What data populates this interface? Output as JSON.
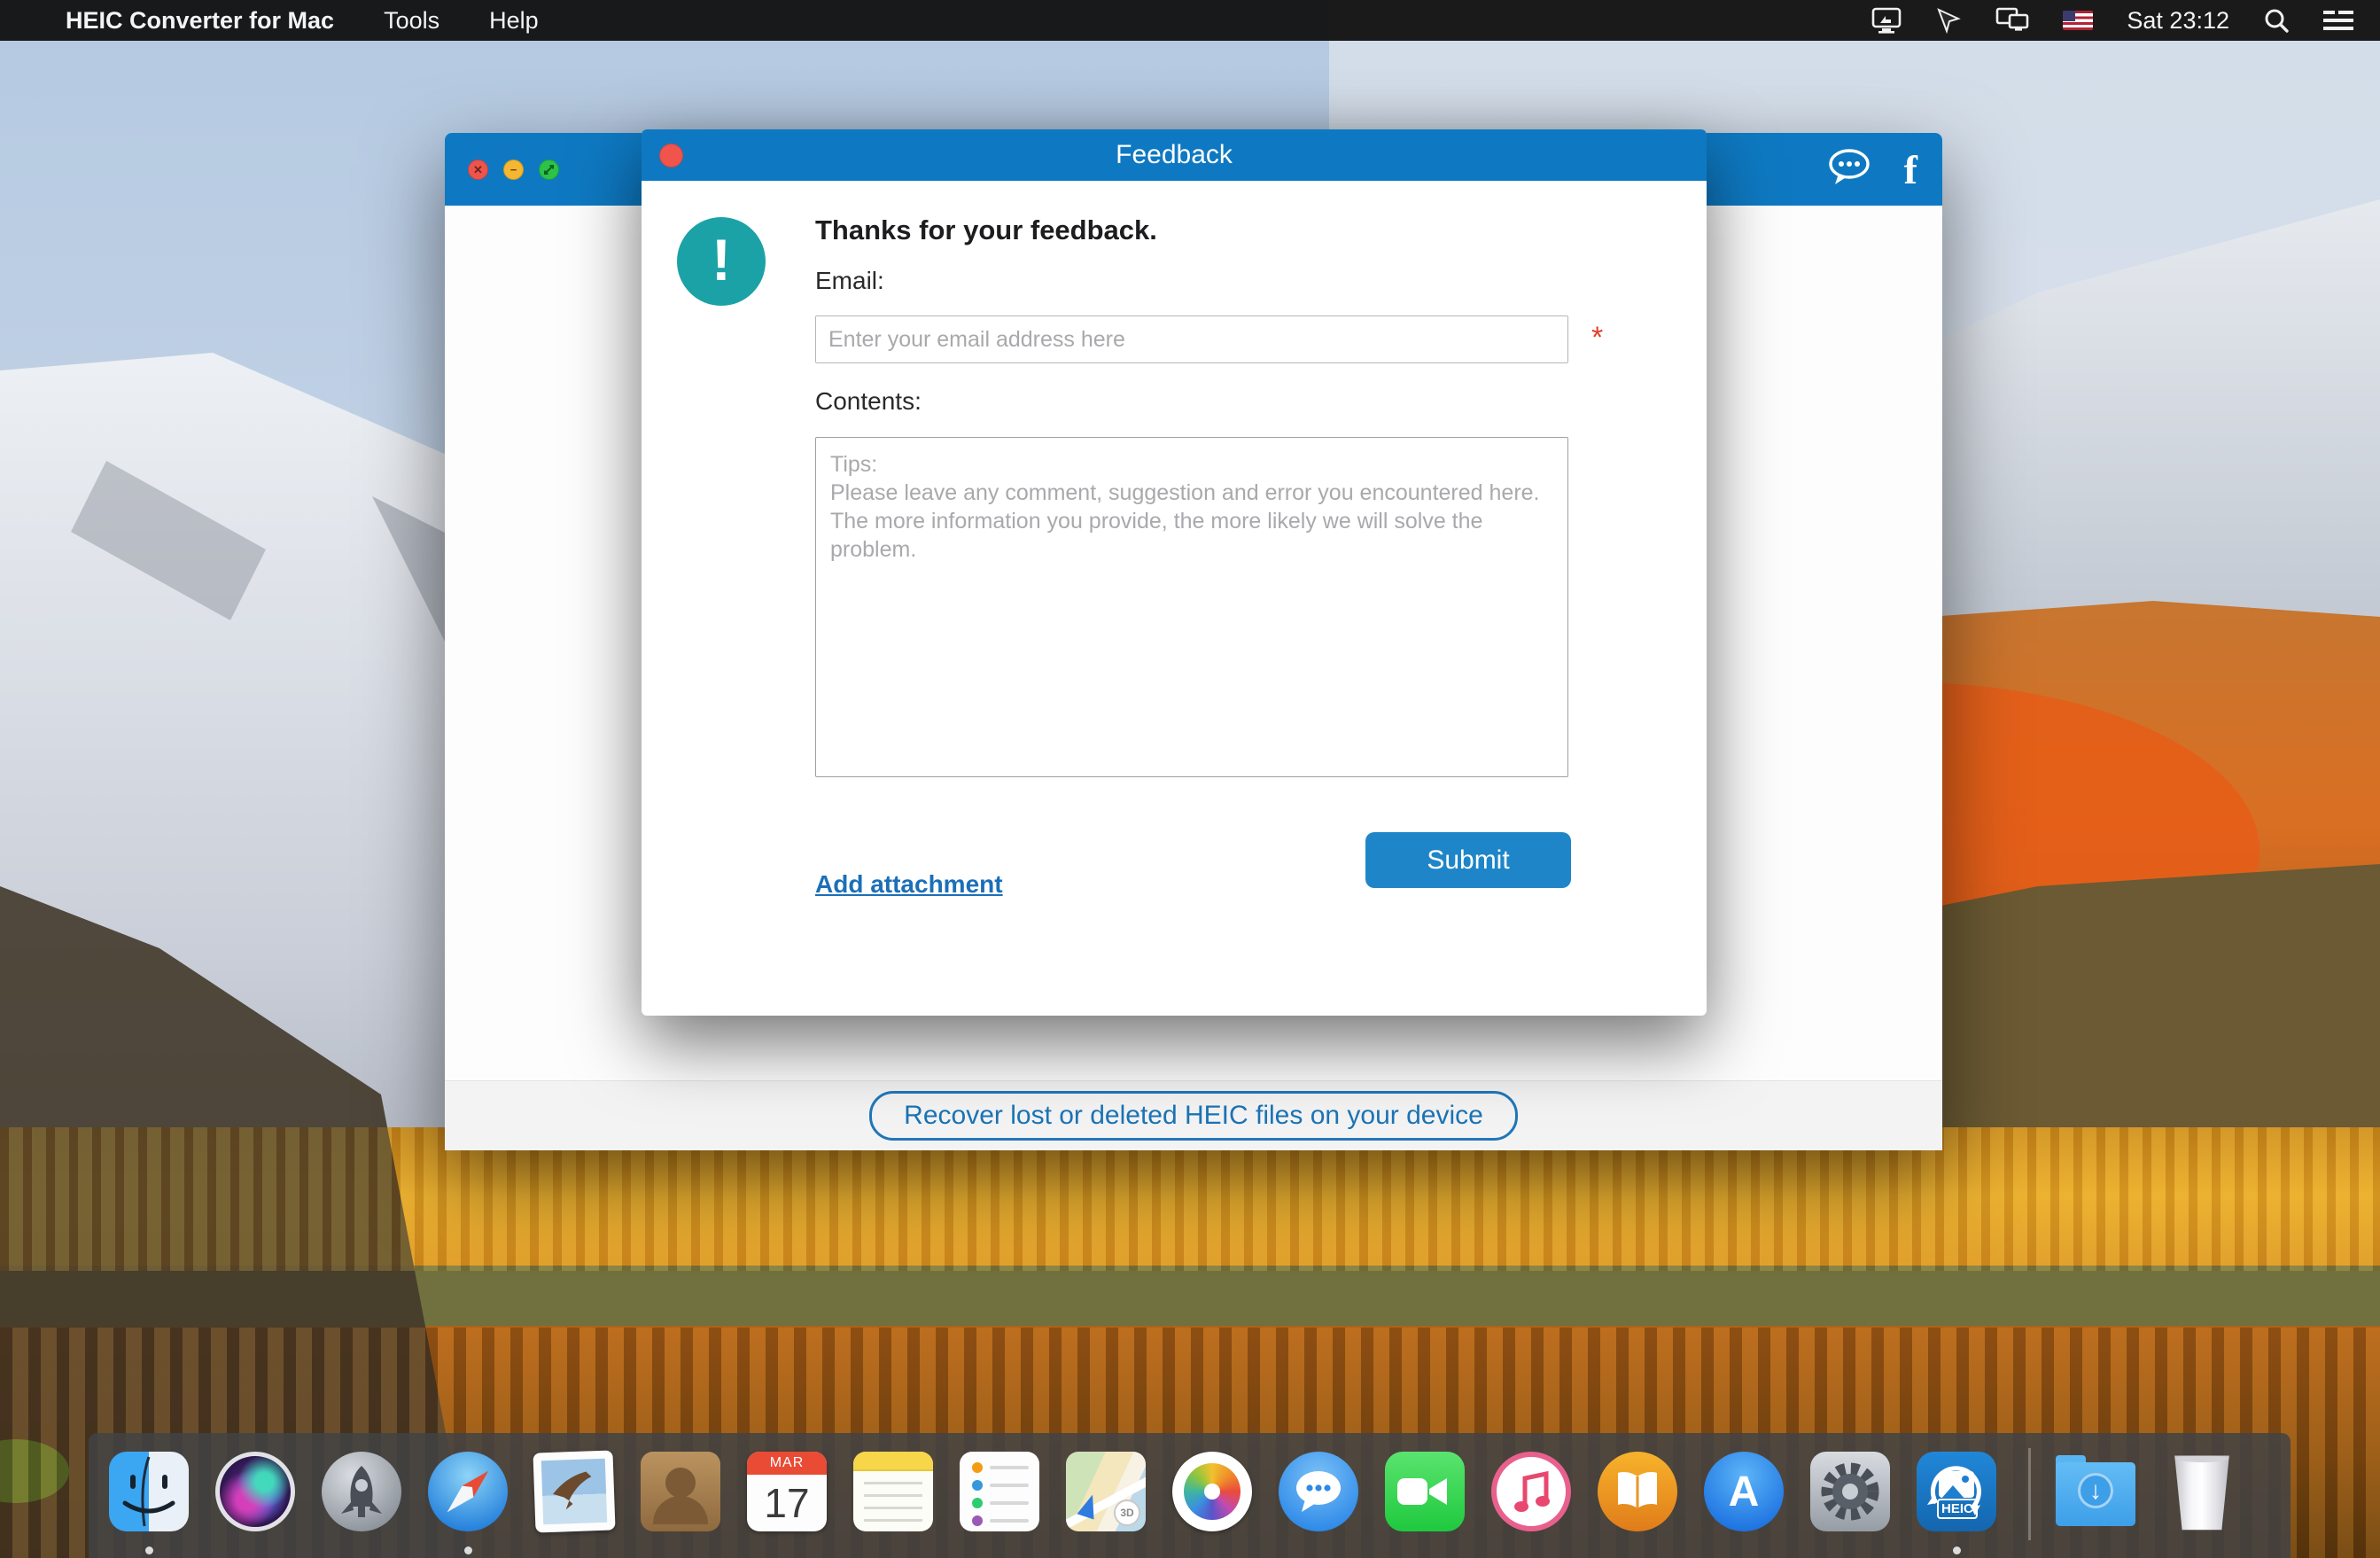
{
  "menu_bar": {
    "apple_icon": "",
    "app_name": "HEIC Converter for Mac",
    "menus": [
      "Tools",
      "Help"
    ],
    "status_icons": [
      "display-mirroring-icon",
      "pointer-icon",
      "displays-icon",
      "us-flag-icon",
      "spotlight-search-icon",
      "notification-center-icon"
    ],
    "time": "Sat 23:12"
  },
  "main_window": {
    "titlebar_icons": [
      "feedback-chat-icon",
      "facebook-icon"
    ],
    "facebook_glyph": "f",
    "footer_button_label": "Recover lost or deleted HEIC files on your device"
  },
  "feedback_dialog": {
    "title": "Feedback",
    "alert_icon": "exclamation-circle-icon",
    "alert_glyph": "!",
    "heading": "Thanks for your feedback.",
    "email_label": "Email:",
    "email_value": "",
    "email_placeholder": "Enter your email address here",
    "required_marker": "*",
    "contents_label": "Contents:",
    "contents_value": "",
    "contents_placeholder": "Tips:\nPlease leave any comment, suggestion and error you encountered here. The more information you provide, the more likely we will solve the problem.",
    "add_attachment_label": "Add attachment",
    "submit_label": "Submit"
  },
  "dock": {
    "items": [
      "finder",
      "siri",
      "launchpad",
      "safari",
      "mail",
      "contacts",
      "calendar",
      "notes",
      "reminders",
      "maps",
      "photos",
      "messages",
      "facetime",
      "itunes",
      "books",
      "app-store",
      "system-preferences",
      "heic-converter",
      "downloads",
      "trash"
    ],
    "calendar_month": "MAR",
    "calendar_day": "17",
    "heic_badge": "HEIC",
    "running_apps": [
      "finder",
      "safari",
      "heic-converter"
    ]
  },
  "colors": {
    "titlebar_blue": "#0e79c2",
    "accent_blue": "#1e86c8",
    "teal_alert": "#1ba2a6",
    "link_blue": "#1b6fb8",
    "required_red": "#e0402a",
    "menubar_black": "#121212",
    "dock_gray": "#424244"
  }
}
